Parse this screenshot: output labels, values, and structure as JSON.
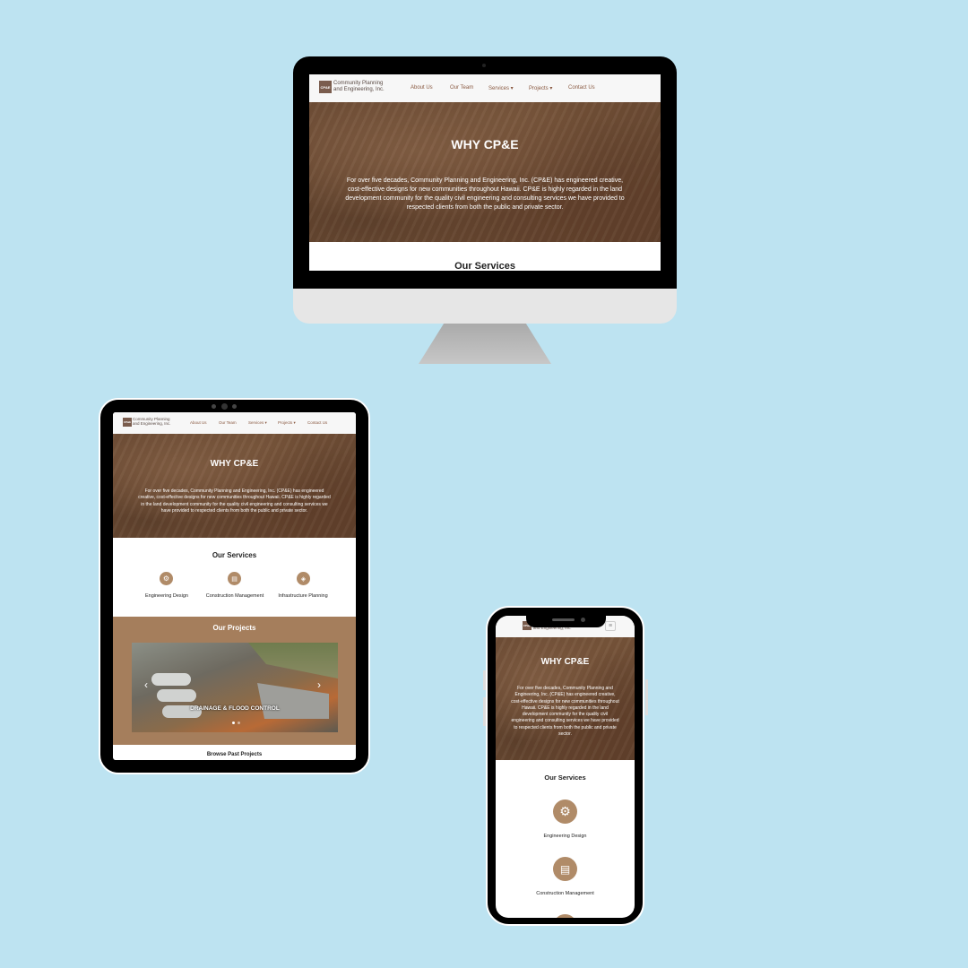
{
  "site": {
    "logo_mark": "CP&E",
    "logo_line1": "Community Planning",
    "logo_line2": "and Engineering, Inc.",
    "nav": {
      "about": "About Us",
      "team": "Our Team",
      "services": "Services ▾",
      "projects": "Projects ▾",
      "contact": "Contact Us"
    },
    "hero": {
      "title": "WHY CP&E",
      "text": "For over five decades, Community Planning and Engineering, Inc. (CP&E) has engineered creative, cost-effective designs for new communities throughout Hawaii. CP&E is highly regarded in the land development community for the quality civil engineering and consulting services we have provided to respected clients from both the public and private sector."
    },
    "services": {
      "title": "Our Services",
      "items": [
        {
          "label": "Engineering Design",
          "icon": "gear-icon"
        },
        {
          "label": "Construction Management",
          "icon": "clipboard-icon"
        },
        {
          "label": "Infrastructure Planning",
          "icon": "blueprint-icon"
        }
      ]
    },
    "projects": {
      "title": "Our Projects",
      "slide_caption": "DRAINAGE & FLOOD CONTROL",
      "prev": "‹",
      "next": "›",
      "browse": "Browse Past Projects"
    },
    "mobile_menu_icon": "≡"
  },
  "colors": {
    "background": "#bde3f1",
    "accent": "#b08b68",
    "projects_bg": "#a57e5c",
    "nav_link": "#8a5a42"
  }
}
